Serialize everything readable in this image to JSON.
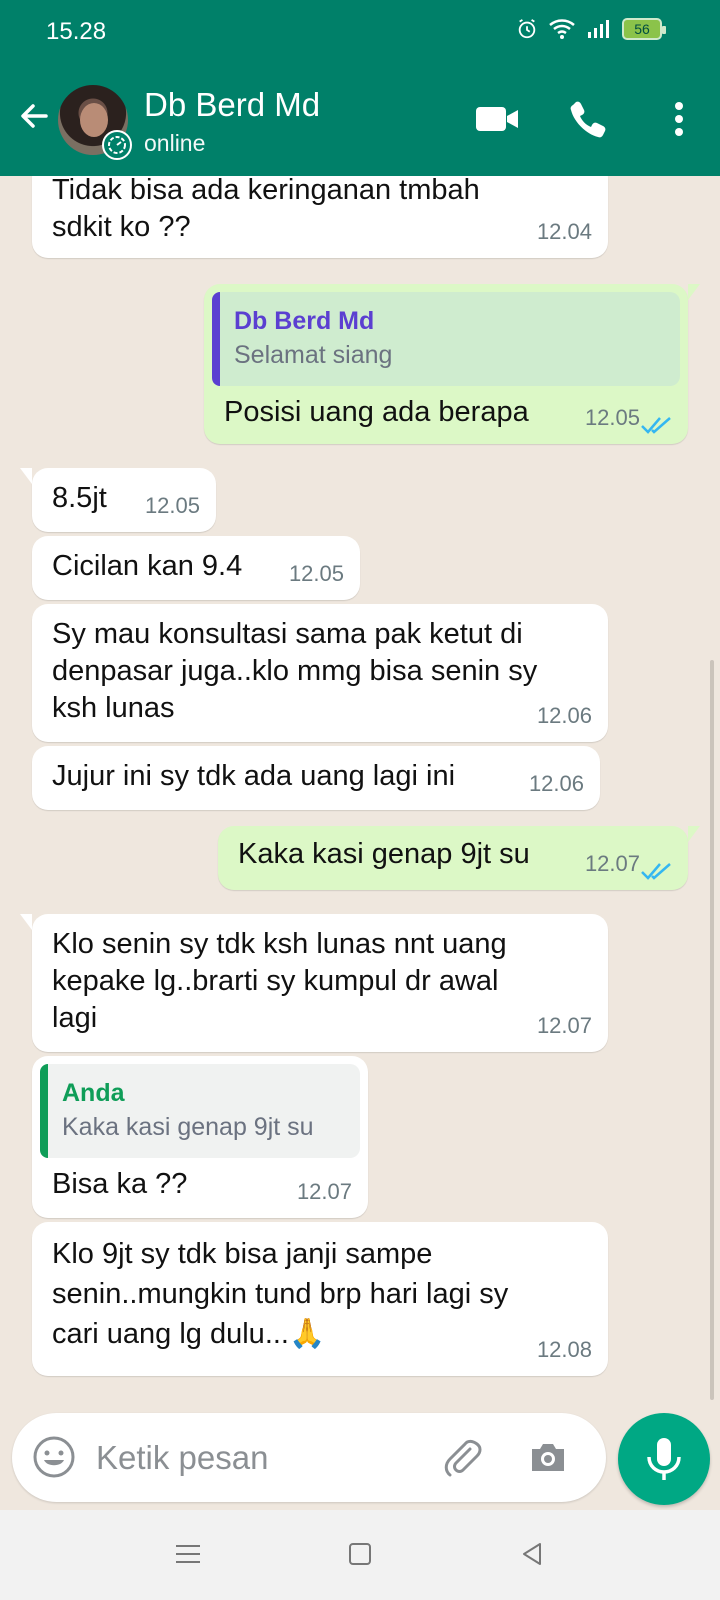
{
  "status_bar": {
    "time": "15.28",
    "battery": "56"
  },
  "header": {
    "contact_name": "Db Berd Md",
    "presence": "online"
  },
  "messages": [
    {
      "text": "Tidak bisa ada keringanan tmbah\nsdkit ko ??",
      "time": "12.04"
    },
    {
      "quote_name": "Db Berd Md",
      "quote_text": "Selamat siang",
      "text": "Posisi uang ada berapa",
      "time": "12.05"
    },
    {
      "text": "8.5jt",
      "time": "12.05"
    },
    {
      "text": "Cicilan kan 9.4",
      "time": "12.05"
    },
    {
      "text": "Sy mau konsultasi sama pak ketut di\ndenpasar juga..klo mmg bisa senin sy\nksh lunas",
      "time": "12.06"
    },
    {
      "text": "Jujur ini sy tdk ada uang lagi ini",
      "time": "12.06"
    },
    {
      "text": "Kaka kasi genap 9jt su",
      "time": "12.07"
    },
    {
      "text": "Klo senin sy tdk ksh lunas nnt uang\nkepake lg..brarti sy kumpul dr awal\nlagi",
      "time": "12.07"
    },
    {
      "quote_name": "Anda",
      "quote_text": "Kaka kasi genap 9jt su",
      "text": "Bisa ka ??",
      "time": "12.07"
    },
    {
      "text": "Klo 9jt sy tdk bisa janji sampe\nsenin..mungkin tund brp hari lagi sy\ncari uang lg dulu...🙏",
      "time": "12.08"
    }
  ],
  "composer": {
    "placeholder": "Ketik pesan"
  },
  "colors": {
    "brand": "#008069",
    "outgoing": "#dcf8c6",
    "incoming": "#ffffff",
    "read_ticks": "#34b7f1",
    "quote_purple": "#5b3fd1",
    "quote_green": "#0f9d58"
  }
}
